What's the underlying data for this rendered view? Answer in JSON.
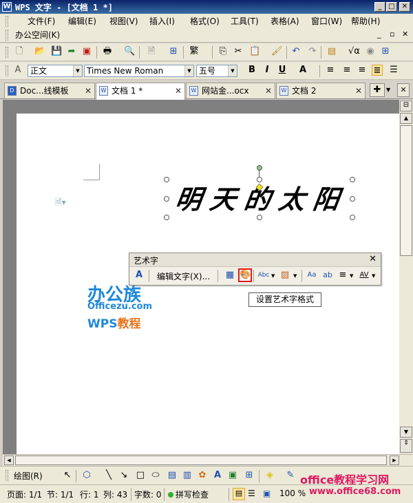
{
  "window": {
    "title": "WPS 文字 - [文档 1 *]",
    "logo_glyph": "W",
    "min_glyph": "_",
    "max_glyph": "□",
    "close_glyph": "✕"
  },
  "menu": {
    "items": [
      "文件(F)",
      "编辑(E)",
      "视图(V)",
      "插入(I)",
      "格式(O)",
      "工具(T)",
      "表格(A)",
      "窗口(W)",
      "帮助(H)"
    ],
    "second_row": "办公空间(K)",
    "doc_min": "_",
    "doc_restore": "▫",
    "doc_close": "✕"
  },
  "format": {
    "style": "正文",
    "font": "Times New Roman",
    "size": "五号",
    "bold": "B",
    "italic": "I",
    "underline": "U",
    "font_color": "A"
  },
  "tabs": [
    {
      "label": "Doc...线模板",
      "icon": "D"
    },
    {
      "label": "文档 1 *",
      "icon": "W"
    },
    {
      "label": "网站金...ocx",
      "icon": "W"
    },
    {
      "label": "文档 2",
      "icon": "W"
    }
  ],
  "tab_close_glyph": "✕",
  "tab_add_glyph": "✚",
  "document": {
    "wordart_text": "明天的太阳"
  },
  "wordart_toolbar": {
    "title": "艺术字",
    "close_glyph": "✕",
    "edit_text": "编辑文字(X)...",
    "spacing_label": "AV",
    "tooltip": "设置艺术字格式"
  },
  "logo": {
    "line1": "办公族",
    "line2": "Officezu.com",
    "line3_prefix": "WPS",
    "line3_suffix": "教程"
  },
  "draw_toolbar": {
    "label": "绘图(R)"
  },
  "status": {
    "page": "页面: 1/1",
    "section": "节: 1/1",
    "row": "行: 1",
    "col": "列: 43",
    "words": "字数: 0",
    "spell": "拼写检查",
    "zoom": "100 %"
  },
  "watermark": {
    "line1": "office教程学习网",
    "line2": "www.office68.com"
  },
  "icons": {
    "new": "new-document-icon",
    "open": "open-folder-icon",
    "save": "save-icon",
    "print": "print-icon",
    "preview": "print-preview-icon",
    "cut": "cut-icon",
    "copy": "copy-icon",
    "paste": "paste-icon",
    "format_painter": "format-painter-icon",
    "undo": "undo-icon",
    "redo": "redo-icon"
  }
}
